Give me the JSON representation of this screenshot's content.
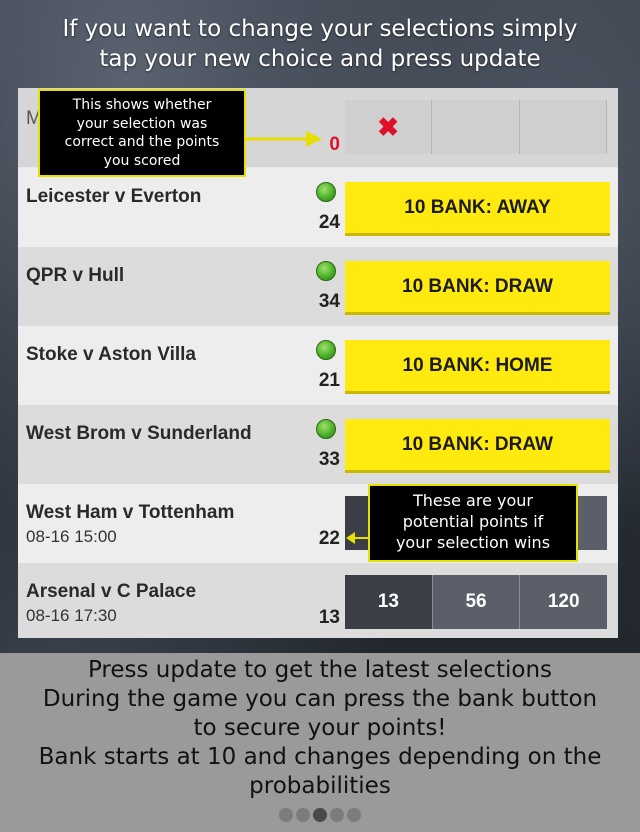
{
  "top_caption": {
    "line1": "If you want to change your selections simply",
    "line2": "tap your new choice and press update"
  },
  "header_row": {
    "partial_label": "M",
    "points": "0",
    "wrong_icon": "x-mark-icon",
    "x_symbol": "✖"
  },
  "matches": [
    {
      "name": "Leicester v Everton",
      "points": "24",
      "status_icon": "green-dot-icon",
      "bank_label": "10 BANK: AWAY"
    },
    {
      "name": "QPR v Hull",
      "points": "34",
      "status_icon": "green-dot-icon",
      "bank_label": "10 BANK: DRAW"
    },
    {
      "name": "Stoke v Aston Villa",
      "points": "21",
      "status_icon": "green-dot-icon",
      "bank_label": "10 BANK: HOME"
    },
    {
      "name": "West Brom v Sunderland",
      "points": "33",
      "status_icon": "green-dot-icon",
      "bank_label": "10 BANK: DRAW"
    },
    {
      "name": "West Ham v Tottenham",
      "time": "08-16 15:00",
      "points": "22"
    },
    {
      "name": "Arsenal v C Palace",
      "time": "08-16 17:30",
      "points": "13",
      "odds": [
        "13",
        "56",
        "120"
      ]
    }
  ],
  "callouts": {
    "result": [
      "This shows whether",
      "your selection was",
      "correct and the points",
      "you scored"
    ],
    "potential": [
      "These are your",
      "potential points if",
      "your selection wins"
    ]
  },
  "bottom_caption": {
    "line1": "Press update to get the latest selections",
    "line2": "During the game you can press the bank button",
    "line3": "to secure your points!",
    "line4": "Bank starts at 10 and changes depending on the",
    "line5": "probabilities"
  },
  "pager": {
    "count": 5,
    "active_index": 2
  },
  "colors": {
    "bank_yellow": "#ffea0f",
    "callout_border": "#e5e000",
    "points_red": "#e0102a",
    "odds_dark": "#5b5f69"
  }
}
